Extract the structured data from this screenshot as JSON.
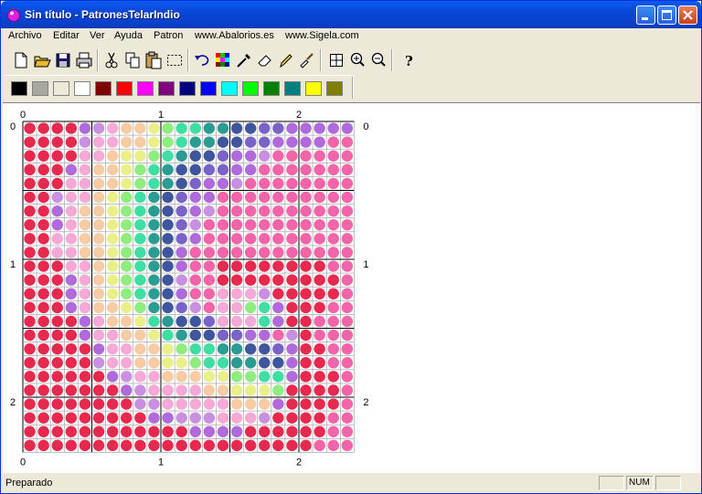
{
  "window": {
    "title": "Sin título - PatronesTelarIndio"
  },
  "menu": [
    "Archivo",
    "Editar",
    "Ver",
    "Ayuda",
    "Patron",
    "www.Abalorios.es",
    "www.Sigela.com"
  ],
  "toolbar": {
    "buttons": [
      "new-icon",
      "open-icon",
      "save-icon",
      "print-icon",
      "cut-icon",
      "copy-icon",
      "paste-icon",
      "select-icon",
      "undo-icon",
      "palette-icon",
      "eyedropper-icon",
      "eraser-icon",
      "pencil-icon",
      "fill-brush-icon",
      "grid-icon",
      "zoom-in-icon",
      "zoom-out-icon",
      "help-icon"
    ]
  },
  "palette": [
    "#000000",
    "#A8A8A0",
    "#ECE9D8",
    "#FFFFFF",
    "#800000",
    "#FF0000",
    "#FF00FF",
    "#800080",
    "#000080",
    "#0000FF",
    "#00FFFF",
    "#00FF00",
    "#008000",
    "#008080",
    "#FFFF00",
    "#808000"
  ],
  "grid": {
    "top_labels": [
      "0",
      "1",
      "2"
    ],
    "bottom_labels": [
      "0",
      "1",
      "2"
    ],
    "left_labels": [
      "0",
      "1",
      "2"
    ],
    "right_labels": [
      "0",
      "1",
      "2"
    ],
    "columns": 24,
    "rows": 24,
    "colors": {
      "r": "#E8294F",
      "p": "#F464A8",
      "v": "#B06ADB",
      "l": "#F6A8D6",
      "o": "#F7CBA3",
      "y": "#E9F08A",
      "g": "#8FEC7E",
      "m": "#3FDFA3",
      "t": "#2A9C94",
      "b": "#3F569E",
      "u": "#7A63C8",
      "w": "#C98FE0"
    },
    "pattern": [
      "rrrrvwlooygmmttbbuuvvvvv",
      "rrrrwllooygmttbbuuvvvvpp",
      "rrrrlloyygmtbbuvvwpppppp",
      "rrrvlooygmtbbuuvvppppppp",
      "rrrllooygmtbuvvwpppppppp",
      "rrwlloygmtbuvvpppppppppp",
      "rrvlooygmtbuvwpppppppppp",
      "rrvlooygmtbuwppppppppppp",
      "rrllooygmtbuvppppppppppp",
      "rrllooygmtbvpppppppppppp",
      "rrrlloygmtbvpprrrrrrrrpp",
      "rrrvloygmtbwpprrrrrrrrrp",
      "rrrvloygmtbvpplllwrrrrrp",
      "rrrvlooygtbuwpllgmvrrrpp",
      "rrrrvlooymtbbulllmvrrppp",
      "rrrrvllooymtbbuuvvpwrppp",
      "rrrrrvllooygmmttbbuvrrpp",
      "rrrrrwllooyygmmttbbvrrpp",
      "rrrrrrvwlloooyyggmmvrrrp",
      "rrrrrrrvwllllooyyygrrrrp",
      "rrrrrrrrwwlllllooovrrrrp",
      "rrrrrrrrrvvwwwlllwrrrrpp",
      "rrrrrrrrrrrrvvvvrrrrrrpp",
      "rrrrrrrrrrrrrrrrrrrrrppp"
    ]
  },
  "status": {
    "text": "Preparado",
    "num": "NUM"
  }
}
